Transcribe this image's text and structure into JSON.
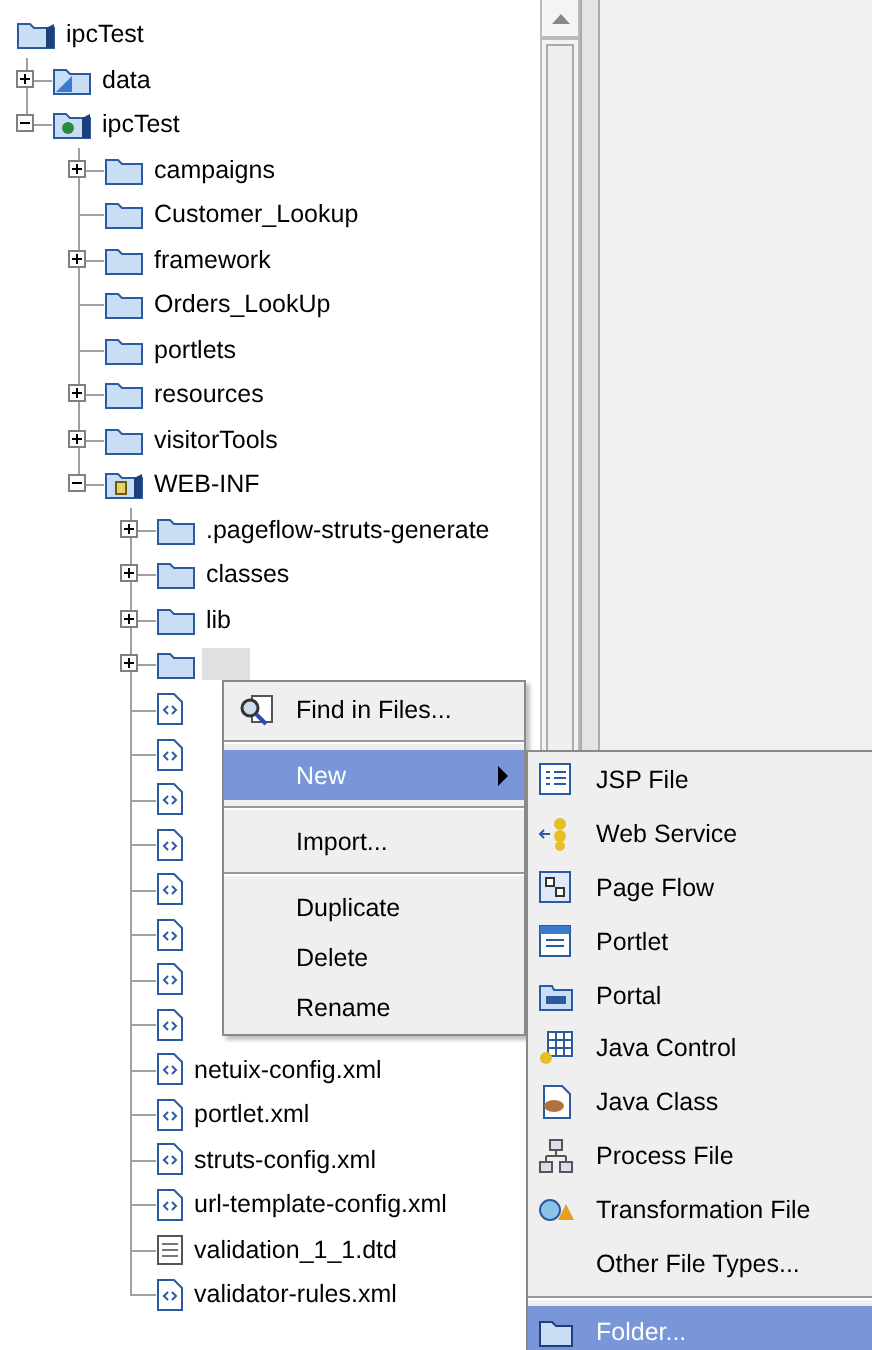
{
  "tree": {
    "label": "ipcTest",
    "kind": "project",
    "selected": false,
    "children": [
      {
        "label": "data",
        "kind": "datafolder",
        "selected": false,
        "expanded": false
      },
      {
        "label": "ipcTest",
        "kind": "webapp",
        "selected": false,
        "expanded": true,
        "children": [
          {
            "label": "campaigns",
            "kind": "folder",
            "selected": false,
            "expanded": false
          },
          {
            "label": "Customer_Lookup",
            "kind": "folder",
            "selected": false
          },
          {
            "label": "framework",
            "kind": "folder",
            "selected": false,
            "expanded": false
          },
          {
            "label": "Orders_LookUp",
            "kind": "folder",
            "selected": false
          },
          {
            "label": "portlets",
            "kind": "folder",
            "selected": false
          },
          {
            "label": "resources",
            "kind": "folder",
            "selected": false,
            "expanded": false
          },
          {
            "label": "visitorTools",
            "kind": "folder",
            "selected": false,
            "expanded": false
          },
          {
            "label": "WEB-INF",
            "kind": "webinf",
            "selected": false,
            "expanded": true,
            "children": [
              {
                "label": ".pageflow-struts-generate",
                "kind": "folder",
                "selected": false,
                "expanded": false
              },
              {
                "label": "classes",
                "kind": "folder",
                "selected": false,
                "expanded": false
              },
              {
                "label": "lib",
                "kind": "folder",
                "selected": false,
                "expanded": false
              },
              {
                "kind": "folder",
                "selected": true,
                "expanded": false
              },
              {
                "kind": "xml",
                "selected": false
              },
              {
                "kind": "xml",
                "selected": false
              },
              {
                "kind": "xml",
                "selected": false
              },
              {
                "kind": "xml",
                "selected": false
              },
              {
                "kind": "xml",
                "selected": false
              },
              {
                "kind": "xml",
                "selected": false
              },
              {
                "kind": "xml",
                "selected": false
              },
              {
                "kind": "xml",
                "selected": false
              },
              {
                "label": "netuix-config.xml",
                "kind": "xml",
                "selected": false
              },
              {
                "label": "portlet.xml",
                "kind": "xml",
                "selected": false
              },
              {
                "label": "struts-config.xml",
                "kind": "xml",
                "selected": false
              },
              {
                "label": "url-template-config.xml",
                "kind": "xml",
                "selected": false
              },
              {
                "label": "validation_1_1.dtd",
                "kind": "dtd",
                "selected": false
              },
              {
                "label": "validator-rules.xml",
                "kind": "xml",
                "selected": false
              }
            ]
          }
        ]
      }
    ]
  },
  "context_menu": [
    {
      "kind": "find",
      "label": "Find in Files...",
      "selected": false,
      "submenu": false
    },
    {
      "kind": "separator"
    },
    {
      "kind": "plain",
      "label": "New",
      "selected": true,
      "submenu": true
    },
    {
      "kind": "separator"
    },
    {
      "kind": "plain",
      "label": "Import...",
      "selected": false,
      "submenu": false
    },
    {
      "kind": "separator"
    },
    {
      "kind": "plain",
      "label": "Duplicate",
      "selected": false,
      "submenu": false
    },
    {
      "kind": "plain",
      "label": "Delete",
      "selected": false,
      "submenu": false
    },
    {
      "kind": "plain",
      "label": "Rename",
      "selected": false,
      "submenu": false
    }
  ],
  "submenu": [
    {
      "kind": "jsp",
      "label": "JSP File",
      "selected": false
    },
    {
      "kind": "webservice",
      "label": "Web Service",
      "selected": false
    },
    {
      "kind": "pageflow",
      "label": "Page Flow",
      "selected": false
    },
    {
      "kind": "portlet",
      "label": "Portlet",
      "selected": false
    },
    {
      "kind": "portal",
      "label": "Portal",
      "selected": false
    },
    {
      "kind": "control",
      "label": "Java Control",
      "selected": false
    },
    {
      "kind": "class",
      "label": "Java Class",
      "selected": false
    },
    {
      "kind": "process",
      "label": "Process File",
      "selected": false
    },
    {
      "kind": "transform",
      "label": "Transformation File",
      "selected": false
    },
    {
      "kind": "plain",
      "label": "Other File Types...",
      "selected": false
    },
    {
      "kind": "separator"
    },
    {
      "kind": "folder",
      "label": "Folder...",
      "selected": true
    }
  ]
}
